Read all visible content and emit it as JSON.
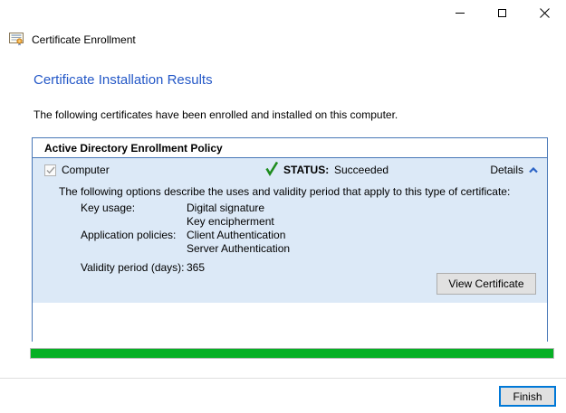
{
  "window": {
    "app_title": "Certificate Enrollment"
  },
  "page": {
    "title": "Certificate Installation Results",
    "intro": "The following certificates have been enrolled and installed on this computer."
  },
  "policy_panel": {
    "title": "Active Directory Enrollment Policy",
    "certificate_row": {
      "checkbox_label": "Computer",
      "checkbox_checked": true,
      "status_label": "STATUS:",
      "status_value": "Succeeded",
      "details_label": "Details",
      "details_expanded": true
    },
    "details": {
      "description": "The following options describe the uses and validity period that apply to this type of certificate:",
      "fields": [
        {
          "label": "Key usage:",
          "values": [
            "Digital signature",
            "Key encipherment"
          ]
        },
        {
          "label": "Application policies:",
          "values": [
            "Client Authentication",
            "Server Authentication"
          ]
        },
        {
          "label": "Validity period (days):",
          "values": [
            "365"
          ]
        }
      ],
      "view_certificate_label": "View Certificate"
    }
  },
  "progress": {
    "percent": 100
  },
  "footer": {
    "finish_label": "Finish"
  },
  "colors": {
    "heading_blue": "#2458c7",
    "panel_border_blue": "#4877b7",
    "panel_body_blue": "#dce9f7",
    "status_check_green": "#1e8c1e",
    "progress_green": "#06b025",
    "details_chevron_blue": "#2b63c6",
    "finish_focus_blue": "#0078d7",
    "button_bg": "#e1e1e1",
    "button_border": "#adadad"
  }
}
